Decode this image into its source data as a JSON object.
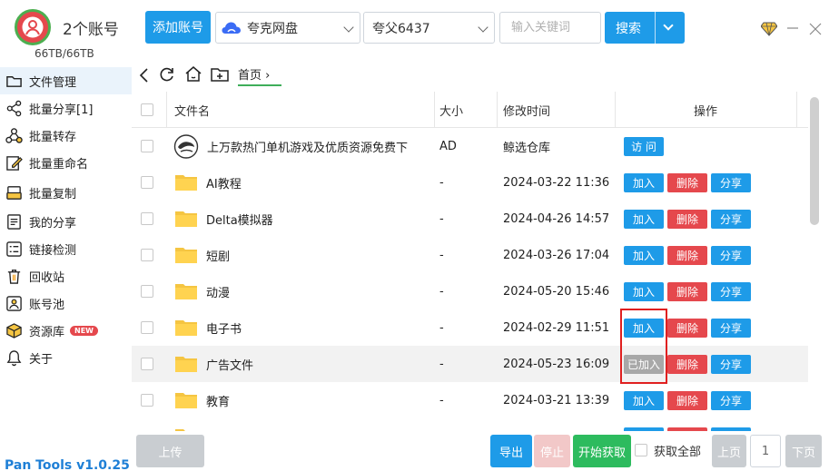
{
  "header": {
    "account_count": "2个账号",
    "storage": "66TB/66TB",
    "add_account_label": "添加账号",
    "drive_select": "夸克网盘",
    "user_select": "夸父6437",
    "search_placeholder": "输入关键词",
    "search_label": "搜索"
  },
  "sidebar": {
    "items": [
      {
        "label": "文件管理",
        "icon": "folder-icon",
        "active": true
      },
      {
        "label": "批量分享[1]",
        "icon": "share-icon"
      },
      {
        "label": "批量转存",
        "icon": "transfer-icon"
      },
      {
        "label": "批量重命名",
        "icon": "rename-icon"
      },
      {
        "label": "批量复制",
        "icon": "copy-icon"
      },
      {
        "label": "我的分享",
        "icon": "document-icon"
      },
      {
        "label": "链接检测",
        "icon": "checklist-icon"
      },
      {
        "label": "回收站",
        "icon": "trash-icon"
      },
      {
        "label": "账号池",
        "icon": "account-icon"
      },
      {
        "label": "资源库",
        "icon": "box-icon",
        "badge": "NEW"
      },
      {
        "label": "关于",
        "icon": "bell-icon"
      }
    ],
    "version": "Pan Tools v1.0.25"
  },
  "path": {
    "breadcrumb": "首页 ›"
  },
  "table": {
    "columns": [
      "文件名",
      "大小",
      "修改时间",
      "操作"
    ],
    "rows": [
      {
        "name": "上万款热门单机游戏及优质资源免费下",
        "size": "AD",
        "time": "鲸选仓库",
        "type": "ad",
        "actions": [
          "访 问"
        ]
      },
      {
        "name": "AI教程",
        "size": "-",
        "time": "2024-03-22 11:36",
        "type": "folder",
        "actions": [
          "加入",
          "删除",
          "分享"
        ]
      },
      {
        "name": "Delta模拟器",
        "size": "-",
        "time": "2024-04-26 14:57",
        "type": "folder",
        "actions": [
          "加入",
          "删除",
          "分享"
        ]
      },
      {
        "name": "短剧",
        "size": "-",
        "time": "2024-03-26 17:04",
        "type": "folder",
        "actions": [
          "加入",
          "删除",
          "分享"
        ]
      },
      {
        "name": "动漫",
        "size": "-",
        "time": "2024-05-20 15:46",
        "type": "folder",
        "actions": [
          "加入",
          "删除",
          "分享"
        ]
      },
      {
        "name": "电子书",
        "size": "-",
        "time": "2024-02-29 11:51",
        "type": "folder",
        "actions": [
          "加入",
          "删除",
          "分享"
        ]
      },
      {
        "name": "广告文件",
        "size": "-",
        "time": "2024-05-23 16:09",
        "type": "folder",
        "actions": [
          "已加入",
          "删除",
          "分享"
        ],
        "highlighted": true
      },
      {
        "name": "教育",
        "size": "-",
        "time": "2024-03-21 13:39",
        "type": "folder",
        "actions": [
          "加入",
          "删除",
          "分享"
        ]
      }
    ]
  },
  "footer": {
    "upload": "上传",
    "export": "导出",
    "stop": "停止",
    "start": "开始获取",
    "select_all": "获取全部",
    "prev": "上页",
    "page": "1",
    "next": "下页"
  },
  "colors": {
    "primary": "#1e9be8",
    "danger": "#e5484d",
    "success": "#2dbb5e",
    "disabled": "#c9cdd1",
    "added": "#a8a8a8",
    "highlight_box": "#e02020"
  }
}
